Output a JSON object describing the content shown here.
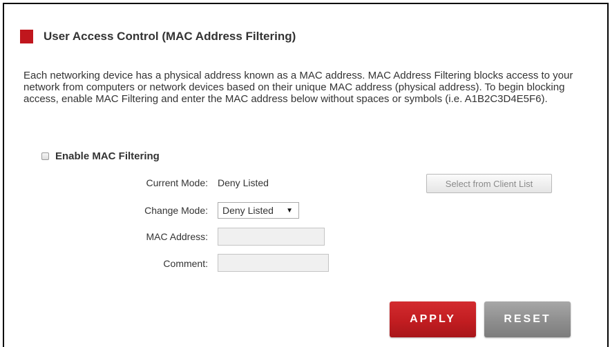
{
  "section": {
    "title": "User Access Control (MAC Address Filtering)",
    "accent_color": "#c0161d"
  },
  "description": "Each networking device has a physical address known as a MAC address. MAC Address Filtering blocks access to your network from computers or network devices based on their unique MAC address (physical address). To begin blocking access, enable MAC Filtering and enter the MAC address below without spaces or symbols (i.e. A1B2C3D4E5F6).",
  "enable_filtering": {
    "label": "Enable MAC Filtering",
    "checked": false
  },
  "form": {
    "current_mode_label": "Current Mode:",
    "current_mode_value": "Deny Listed",
    "change_mode_label": "Change Mode:",
    "change_mode_selected": "Deny Listed",
    "mac_address_label": "MAC Address:",
    "mac_address_value": "",
    "comment_label": "Comment:",
    "comment_value": ""
  },
  "buttons": {
    "select_client": "Select from Client List",
    "apply": "APPLY",
    "reset": "RESET"
  }
}
